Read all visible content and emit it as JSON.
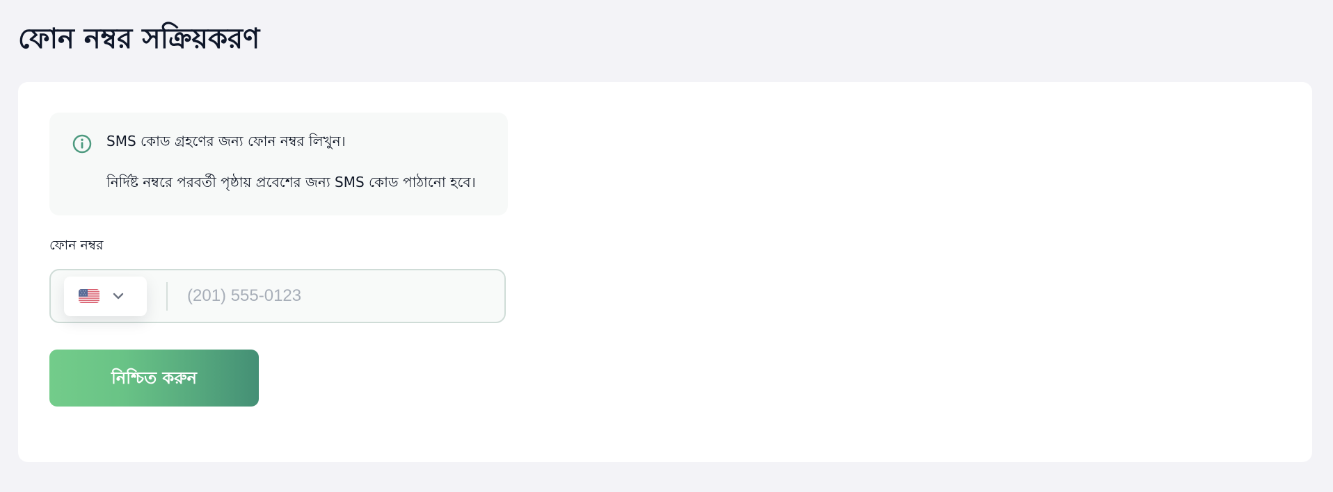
{
  "page": {
    "title": "ফোন নম্বর সক্রিয়করণ"
  },
  "info": {
    "icon": "info-circle-icon",
    "line1": "SMS কোড গ্রহণের জন্য ফোন নম্বর লিখুন।",
    "line2": "নির্দিষ্ট নম্বরে পরবর্তী পৃষ্ঠায় প্রবেশের জন্য SMS কোড পাঠানো হবে।"
  },
  "phone": {
    "label": "ফোন নম্বর",
    "placeholder": "(201) 555-0123",
    "value": "",
    "country_flag": "us-flag-icon",
    "dropdown_icon": "chevron-down-icon"
  },
  "actions": {
    "confirm_label": "নিশ্চিত করুন"
  },
  "colors": {
    "background": "#f3f3f7",
    "card": "#ffffff",
    "info_box": "#f7f9f8",
    "info_icon": "#4d9a7f",
    "field_border": "#cfdcd7",
    "button_start": "#73cc8a",
    "button_end": "#448f75",
    "placeholder": "#a7aeb8"
  }
}
